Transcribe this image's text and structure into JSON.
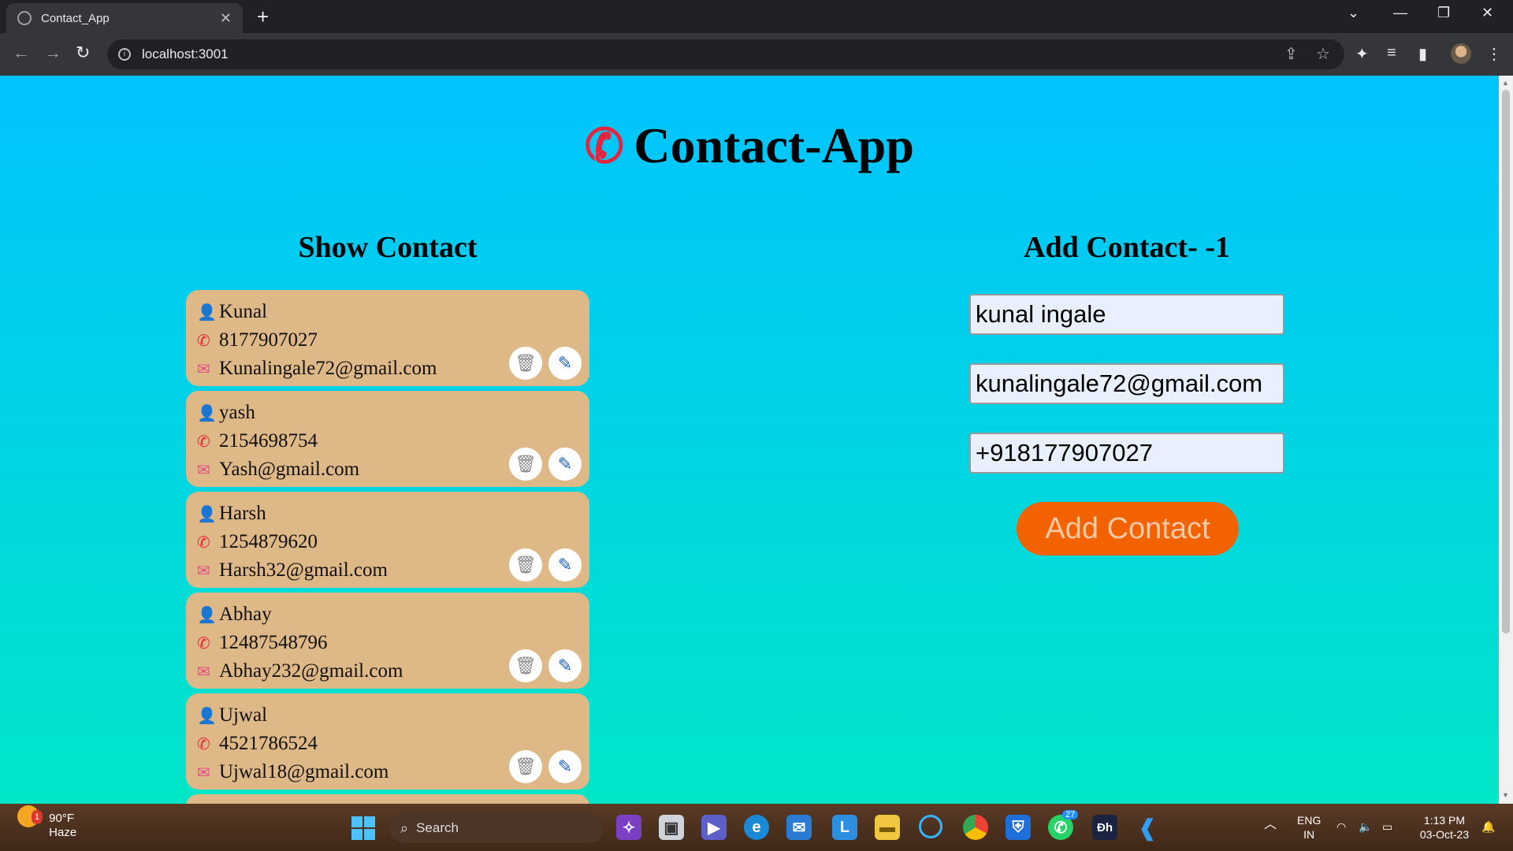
{
  "browser": {
    "tab_title": "Contact_App",
    "new_tab": "+",
    "url": "localhost:3001"
  },
  "app": {
    "title": "Contact-App",
    "show_heading": "Show Contact",
    "add_heading": "Add Contact- -1",
    "contacts": [
      {
        "name": "Kunal",
        "phone": "8177907027",
        "email": "Kunalingale72@gmail.com"
      },
      {
        "name": "yash",
        "phone": "2154698754",
        "email": "Yash@gmail.com"
      },
      {
        "name": "Harsh",
        "phone": "1254879620",
        "email": "Harsh32@gmail.com"
      },
      {
        "name": "Abhay",
        "phone": "12487548796",
        "email": "Abhay232@gmail.com"
      },
      {
        "name": "Ujwal",
        "phone": "4521786524",
        "email": "Ujwal18@gmail.com"
      }
    ],
    "form": {
      "name_value": "kunal ingale",
      "email_value": "kunalingale72@gmail.com",
      "phone_value": "+918177907027",
      "submit_label": "Add Contact"
    }
  },
  "taskbar": {
    "temperature": "90°F",
    "weather": "Haze",
    "weather_badge": "1",
    "search_label": "Search",
    "whatsapp_badge": "27",
    "lang": "ENG",
    "region": "IN",
    "time": "1:13 PM",
    "date": "03-Oct-23"
  },
  "colors": {
    "card_bg": "#deb887",
    "accent_button": "#f26300",
    "gradient_top": "#00c3ff",
    "gradient_bottom": "#00e6c8"
  }
}
